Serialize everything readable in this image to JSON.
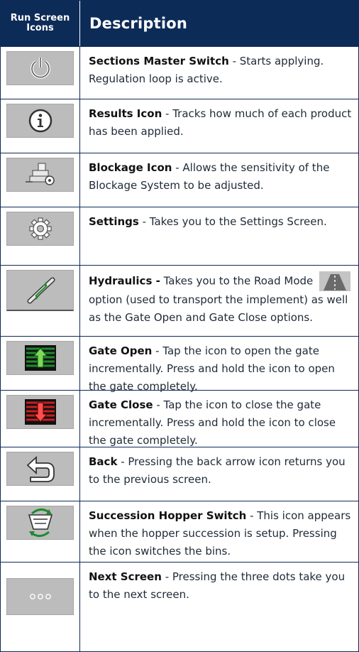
{
  "header": {
    "icons_label_line1": "Run Screen",
    "icons_label_line2": "Icons",
    "description_label": "Description"
  },
  "rows": [
    {
      "icon": "power-icon",
      "title": "Sections Master Switch",
      "sep": " - ",
      "text": "Starts applying. Regulation loop is active."
    },
    {
      "icon": "info-icon",
      "title": "Results Icon",
      "sep": " - ",
      "text": "Tracks how much of each product has been applied."
    },
    {
      "icon": "blockage-icon",
      "title": "Blockage Icon",
      "sep": " - ",
      "text": "Allows the sensitivity of the Blockage System to be adjusted."
    },
    {
      "icon": "gear-icon",
      "title": "Settings",
      "sep": " - ",
      "text": "Takes you to the Settings Screen."
    },
    {
      "icon": "hydraulic-cylinder-icon",
      "title": "Hydraulics -",
      "sep": " ",
      "text_before": "Takes you to the Road Mode",
      "text": "option (used to transport the implement) as well as the Gate Open and Gate Close options."
    },
    {
      "icon": "gate-open-icon",
      "title": "Gate Open",
      "sep": " - ",
      "text": "Tap the icon to open the gate incrementally. Press and hold the icon to open the gate completely."
    },
    {
      "icon": "gate-close-icon",
      "title": "Gate Close",
      "sep": " - ",
      "text": "Tap the icon to close the gate incrementally. Press and hold the icon to close the gate completely."
    },
    {
      "icon": "back-arrow-icon",
      "title": "Back",
      "sep": " - ",
      "text": "Pressing the back arrow icon returns you to the previous screen."
    },
    {
      "icon": "hopper-switch-icon",
      "title": "Succession Hopper Switch",
      "sep": " - ",
      "text": "This icon appears when the hopper succession is setup. Pressing the icon switches the bins."
    },
    {
      "icon": "more-dots-icon",
      "title": "Next Screen",
      "sep": " - ",
      "text": "Pressing the three dots take you to the next screen."
    }
  ],
  "colors": {
    "header_bg": "#0d2b57",
    "tile_bg": "#bcbcbc",
    "gate_open_green": "#1f8a2e",
    "gate_close_red": "#c81e1e"
  }
}
